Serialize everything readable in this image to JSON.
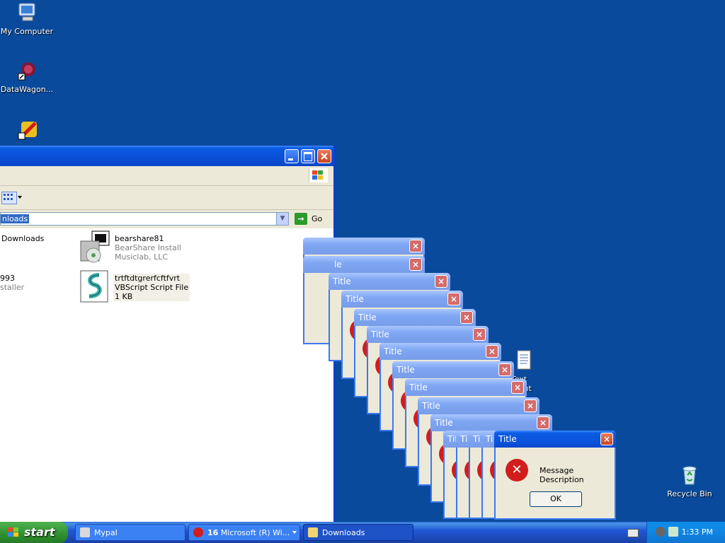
{
  "desktop": {
    "icons": [
      {
        "label": "My Computer"
      },
      {
        "label": "DataWagon..."
      },
      {
        "label": "Text\nment"
      },
      {
        "label": "Recycle Bin"
      }
    ]
  },
  "explorer": {
    "address": "nloads",
    "go_label": "Go",
    "files": [
      {
        "name": "Downloads",
        "line2": "",
        "line3": ""
      },
      {
        "name": "bearshare81",
        "line2": "BearShare Install",
        "line3": "Musiclab, LLC"
      },
      {
        "name": "993",
        "line2": "staller",
        "line3": ""
      },
      {
        "name": "trtftdtgrerfcftfvrt",
        "line2": "VBScript Script File",
        "line3": "1 KB"
      }
    ]
  },
  "dialogs": {
    "title": "Title",
    "front": {
      "title": "Title",
      "message": "Message Description",
      "ok_label": "OK"
    },
    "stack_titles": [
      "",
      "le",
      "Title",
      "Title",
      "Title",
      "Title",
      "Title",
      "Title",
      "Title",
      "Title",
      "Title",
      "Tit",
      "Ti",
      "Ti",
      "Ti"
    ]
  },
  "taskbar": {
    "start_label": "start",
    "tasks": [
      {
        "label": "Mypal"
      },
      {
        "count": "16",
        "label": "Microsoft (R) Wi..."
      },
      {
        "label": "Downloads"
      }
    ],
    "clock": "1:33 PM"
  },
  "colors": {
    "desktop": "#0a4a9c",
    "titlebar_active": "#0a52dc",
    "titlebar_inactive": "#7fa6f3",
    "error_red": "#d21d1d"
  }
}
